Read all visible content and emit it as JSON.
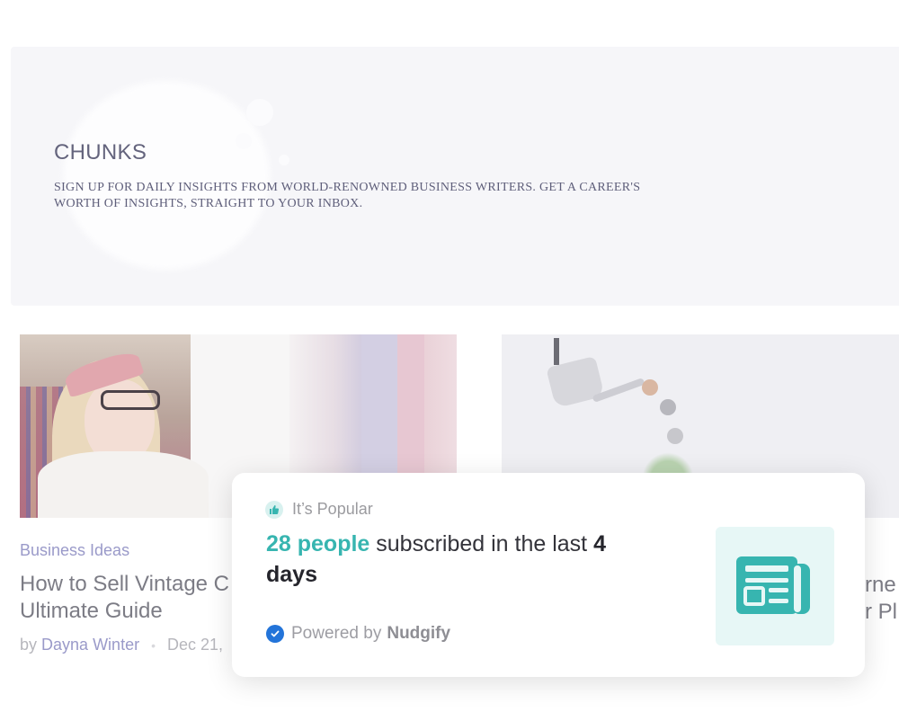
{
  "hero": {
    "title": "CHUNKS",
    "description": "SIGN UP FOR DAILY INSIGHTS FROM WORLD-RENOWNED BUSINESS WRITERS. GET A CAREER'S WORTH OF INSIGHTS, STRAIGHT TO YOUR INBOX."
  },
  "articles": [
    {
      "category": "Business Ideas",
      "title_line1": "How to Sell Vintage C",
      "title_line2": "Ultimate Guide",
      "by": "by",
      "author": "Dayna Winter",
      "date": "Dec 21,"
    },
    {
      "title_line1": "rne",
      "title_line2": "r Pl"
    }
  ],
  "popup": {
    "tag": "It’s Popular",
    "count_text": "28 people",
    "msg_middle": " subscribed in the last ",
    "days_text": "4 days",
    "powered_prefix": "Powered by",
    "powered_brand": "Nudgify",
    "icon": "newspaper-icon",
    "accent_color": "#37b5b0",
    "check_color": "#2374d9"
  }
}
